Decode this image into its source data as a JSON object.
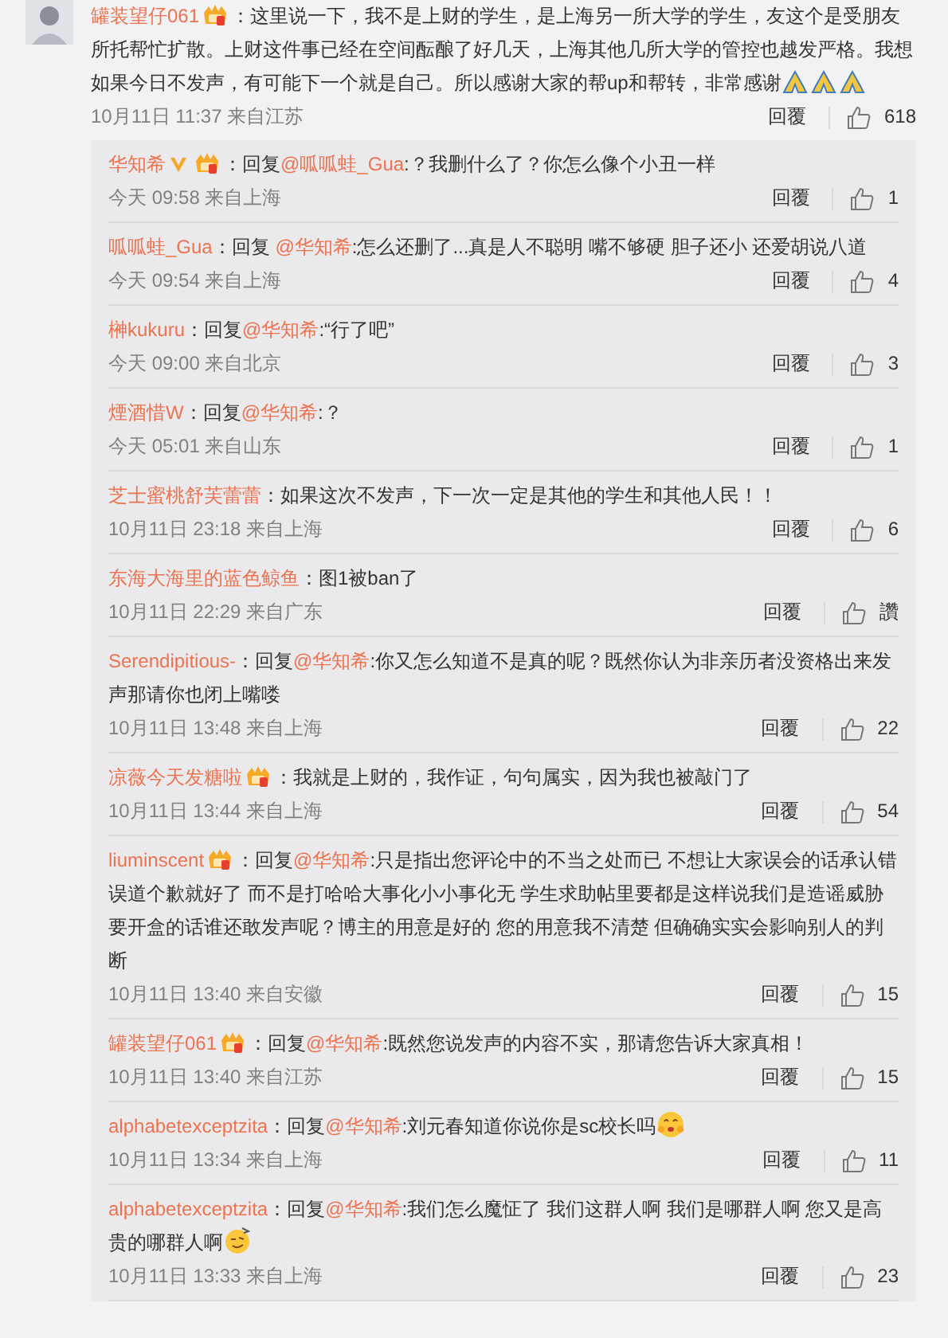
{
  "comment": {
    "user": "罐装望仔061",
    "badges": [
      {
        "kind": "vip"
      }
    ],
    "body": [
      {
        "kind": "text",
        "text": "：这里说一下，我不是上财的学生，是上海另一所大学的学生，友这个是受朋友所托帮忙扩散。上财这件事已经在空间酝酿了好几天，上海其他几所大学的管控也越发严格。我想如果今日不发声，有可能下一个就是自己。所以感谢大家的帮up和帮转，非常感谢"
      }
    ],
    "emojis": [
      {
        "kind": "pray"
      },
      {
        "kind": "pray"
      },
      {
        "kind": "pray"
      }
    ],
    "meta": "10月11日 11:37 来自江苏",
    "reply_label": "回覆",
    "likes": "618"
  },
  "replies": [
    {
      "user": "华知希",
      "badges": [
        {
          "kind": "verified"
        },
        {
          "kind": "vip"
        }
      ],
      "body": [
        {
          "kind": "text",
          "text": "：回复"
        },
        {
          "kind": "mention",
          "text": "@呱呱蛙_Gua"
        },
        {
          "kind": "text",
          "text": ":？我删什么了？你怎么像个小丑一样"
        }
      ],
      "meta": "今天 09:58 来自上海",
      "reply_label": "回覆",
      "likes": "1"
    },
    {
      "user": "呱呱蛙_Gua",
      "body": [
        {
          "kind": "text",
          "text": "：回复 "
        },
        {
          "kind": "mention",
          "text": "@华知希"
        },
        {
          "kind": "text",
          "text": ":怎么还删了...真是人不聪明 嘴不够硬 胆子还小 还爱胡说八道"
        }
      ],
      "meta": "今天 09:54 来自上海",
      "reply_label": "回覆",
      "likes": "4"
    },
    {
      "user": "榊kukuru",
      "body": [
        {
          "kind": "text",
          "text": "：回复"
        },
        {
          "kind": "mention",
          "text": "@华知希"
        },
        {
          "kind": "text",
          "text": ":“行了吧”"
        }
      ],
      "meta": "今天 09:00 来自北京",
      "reply_label": "回覆",
      "likes": "3"
    },
    {
      "user": "煙酒惜W",
      "body": [
        {
          "kind": "text",
          "text": "：回复"
        },
        {
          "kind": "mention",
          "text": "@华知希"
        },
        {
          "kind": "text",
          "text": ":？"
        }
      ],
      "meta": "今天 05:01 来自山东",
      "reply_label": "回覆",
      "likes": "1"
    },
    {
      "user": "芝士蜜桃舒芙蕾蕾",
      "body": [
        {
          "kind": "text",
          "text": "：如果这次不发声，下一次一定是其他的学生和其他人民！！"
        }
      ],
      "meta": "10月11日 23:18 来自上海",
      "reply_label": "回覆",
      "likes": "6"
    },
    {
      "user": "东海大海里的蓝色鲸鱼",
      "body": [
        {
          "kind": "text",
          "text": "：图1被ban了"
        }
      ],
      "meta": "10月11日 22:29 来自广东",
      "reply_label": "回覆",
      "likes": "讚"
    },
    {
      "user": "Serendipitious-",
      "body": [
        {
          "kind": "text",
          "text": "：回复"
        },
        {
          "kind": "mention",
          "text": "@华知希"
        },
        {
          "kind": "text",
          "text": ":你又怎么知道不是真的呢？既然你认为非亲历者没资格出来发声那请你也闭上嘴喽"
        }
      ],
      "meta": "10月11日 13:48 来自上海",
      "reply_label": "回覆",
      "likes": "22"
    },
    {
      "user": "凉薇今天发糖啦",
      "badges": [
        {
          "kind": "vip"
        }
      ],
      "body": [
        {
          "kind": "text",
          "text": "：我就是上财的，我作证，句句属实，因为我也被敲门了"
        }
      ],
      "meta": "10月11日 13:44 来自上海",
      "reply_label": "回覆",
      "likes": "54"
    },
    {
      "user": "liuminscent",
      "badges": [
        {
          "kind": "vip"
        }
      ],
      "body": [
        {
          "kind": "text",
          "text": "：回复"
        },
        {
          "kind": "mention",
          "text": "@华知希"
        },
        {
          "kind": "text",
          "text": ":只是指出您评论中的不当之处而已 不想让大家误会的话承认错误道个歉就好了 而不是打哈哈大事化小小事化无 学生求助帖里要都是这样说我们是造谣威胁要开盒的话谁还敢发声呢？博主的用意是好的 您的用意我不清楚 但确确实实会影响别人的判断"
        }
      ],
      "meta": "10月11日 13:40 来自安徽",
      "reply_label": "回覆",
      "likes": "15"
    },
    {
      "user": "罐装望仔061",
      "badges": [
        {
          "kind": "vip"
        }
      ],
      "body": [
        {
          "kind": "text",
          "text": "：回复"
        },
        {
          "kind": "mention",
          "text": "@华知希"
        },
        {
          "kind": "text",
          "text": ":既然您说发声的内容不实，那请您告诉大家真相！"
        }
      ],
      "meta": "10月11日 13:40 来自江苏",
      "reply_label": "回覆",
      "likes": "15"
    },
    {
      "user": "alphabetexceptzita",
      "body": [
        {
          "kind": "text",
          "text": "：回复"
        },
        {
          "kind": "mention",
          "text": "@华知希"
        },
        {
          "kind": "text",
          "text": ":刘元春知道你说你是sc校长吗"
        }
      ],
      "emojis": [
        {
          "kind": "blush"
        }
      ],
      "meta": "10月11日 13:34 来自上海",
      "reply_label": "回覆",
      "likes": "11"
    },
    {
      "user": "alphabetexceptzita",
      "body": [
        {
          "kind": "text",
          "text": "：回复"
        },
        {
          "kind": "mention",
          "text": "@华知希"
        },
        {
          "kind": "text",
          "text": ":我们怎么魔怔了 我们这群人啊 我们是哪群人啊 您又是高贵的哪群人啊"
        }
      ],
      "emojis": [
        {
          "kind": "smug"
        }
      ],
      "meta": "10月11日 13:33 来自上海",
      "reply_label": "回覆",
      "likes": "23"
    }
  ]
}
